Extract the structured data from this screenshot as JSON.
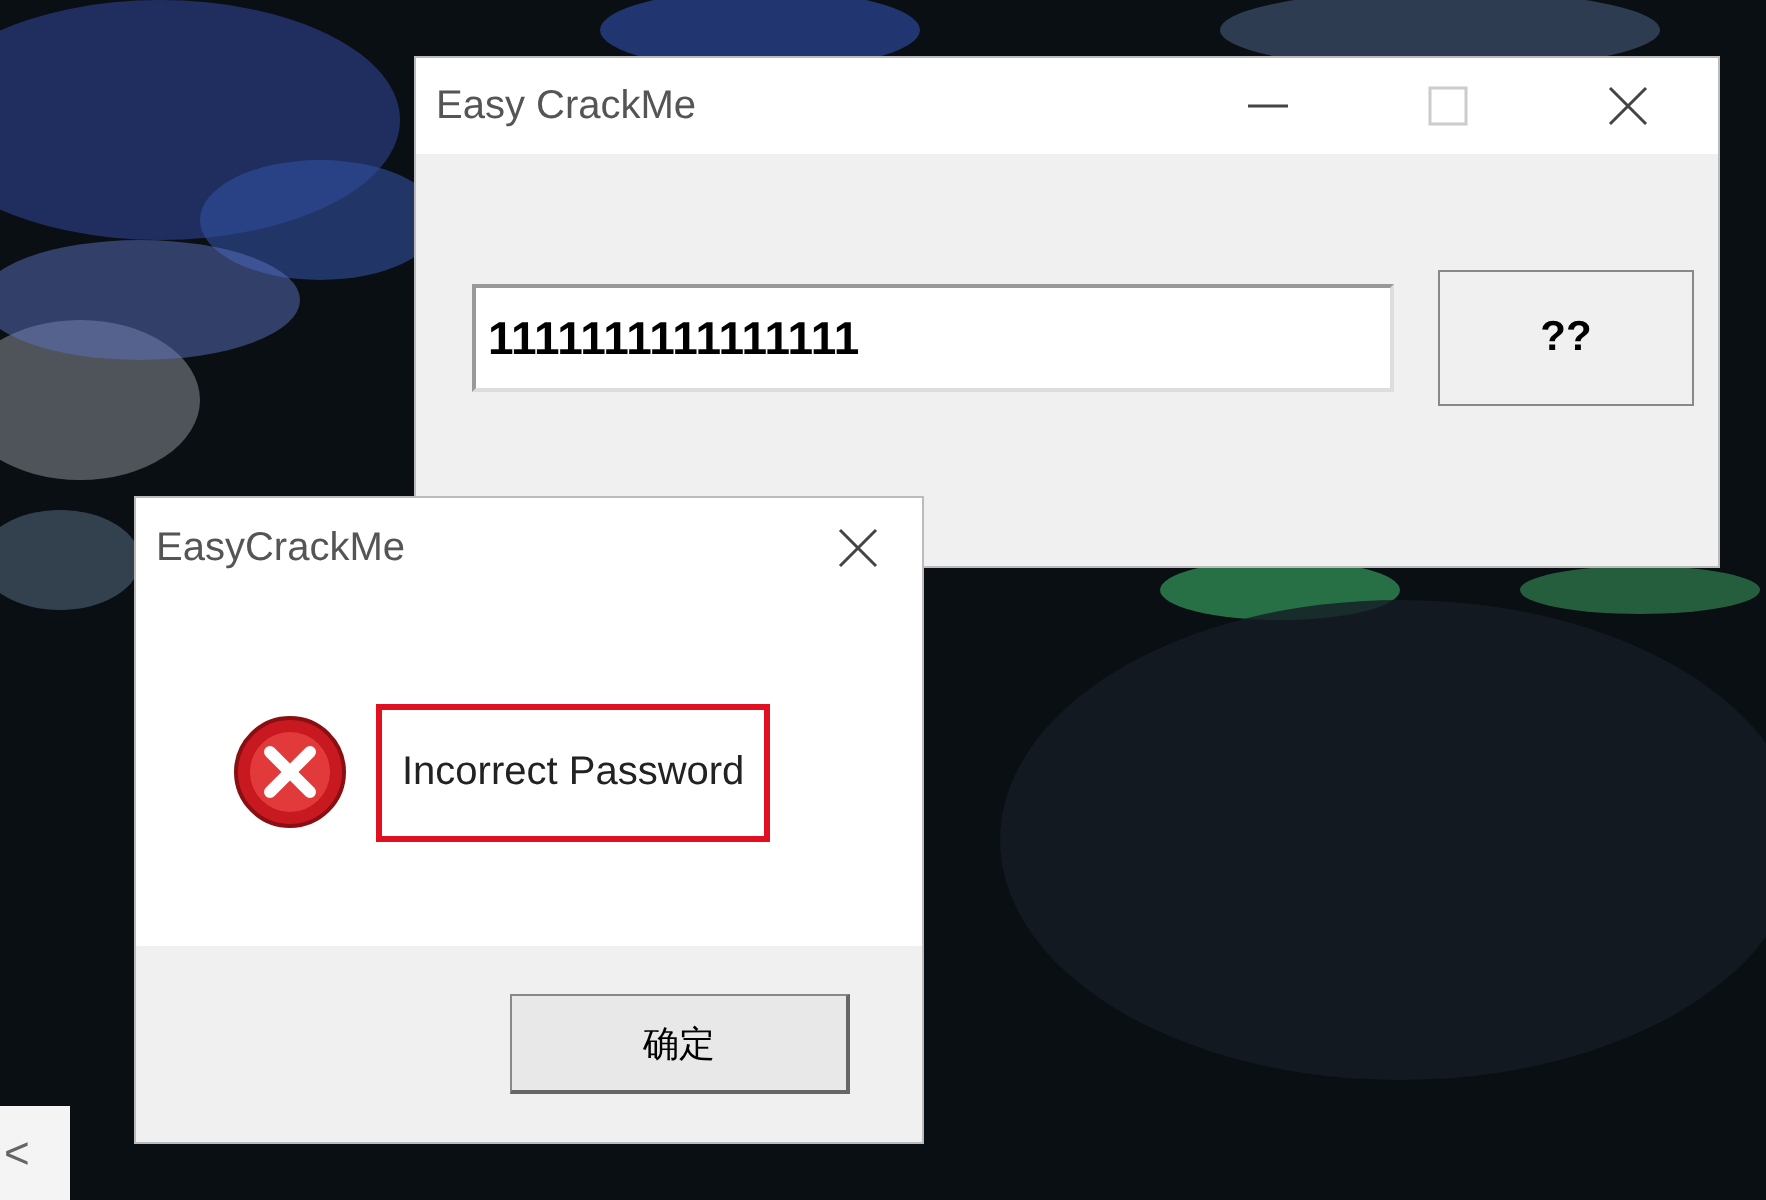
{
  "main_window": {
    "title": "Easy CrackMe",
    "maximize_disabled": true,
    "input": {
      "value": "1111111111111111"
    },
    "button": "??"
  },
  "dialog": {
    "title": "EasyCrackMe",
    "kind": "error",
    "message": "Incorrect Password",
    "message_highlighted": true,
    "button": "确定"
  },
  "side_tab": {
    "label": "<"
  }
}
